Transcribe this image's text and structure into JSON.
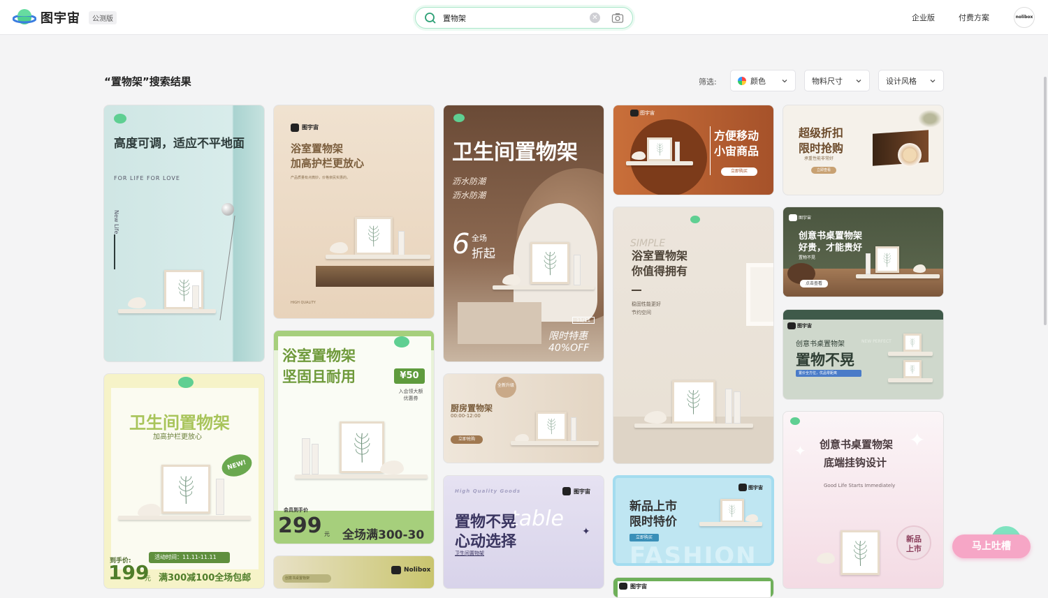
{
  "header": {
    "logo_text": "图宇宙",
    "beta_badge": "公测版",
    "search_value": "置物架",
    "nav_enterprise": "企业版",
    "nav_pricing": "付费方案",
    "avatar_text": "nolibox"
  },
  "results": {
    "title": "“置物架”搜索结果",
    "filter_label": "筛选:",
    "filter_color": "颜色",
    "filter_size": "物料尺寸",
    "filter_style": "设计风格"
  },
  "cards": {
    "c1": {
      "title": "高度可调，适应不平地面",
      "sub": "FOR LIFE FOR LOVE",
      "side": "New Life"
    },
    "c2": {
      "brand": "图宇宙",
      "title": "浴室置物架\n加高护栏更放心",
      "desc": "产品质量有点微妙，价格亲民实惠的。",
      "foot": "HIGH QUALITY"
    },
    "c3": {
      "title": "卫生间置物架",
      "sub1": "沥水防潮",
      "sub2": "沥水防潮",
      "big": "6",
      "big_a": "全场",
      "big_b": "折起",
      "date": "11/11",
      "sale": "限时特惠",
      "off": "40%OFF"
    },
    "c4": {
      "brand": "图宇宙",
      "title1": "方便移动",
      "title2": "小宙商品",
      "btn": "立即购买"
    },
    "c5": {
      "title1": "超级折扣",
      "title2": "限时抢购",
      "sub": "承重性能非常好",
      "btn": "立即查看"
    },
    "c6": {
      "title": "卫生间置物架",
      "sub": "加高护栏更放心",
      "tag": "NEW!",
      "price_label": "到手价:",
      "activity": "活动时间：11.11-11.11",
      "price": "199",
      "unit": "元",
      "promo": "满300减100全场包邮"
    },
    "c7": {
      "title1": "浴室置物架",
      "title2": "坚固且耐用",
      "coupon": "¥50",
      "coupon_sub": "入会领大额\n优惠券",
      "member": "会员到手价",
      "price": "299",
      "unit": "元",
      "promo": "全场满300-30"
    },
    "c8": {
      "badge": "全新升级",
      "title": "厨房置物架",
      "time": "00:00-12:00",
      "btn": "立即抢购"
    },
    "c9": {
      "script": "SIMPLE",
      "title1": "浴室置物架",
      "title2": "你值得拥有",
      "l1": "稳固性能更好",
      "l2": "节约空间"
    },
    "c10": {
      "brand": "图宇宙",
      "title1": "创意书桌置物架",
      "title2": "好贵，才能贵好",
      "sub": "置物不晃",
      "btn": "点击查看"
    },
    "c11": {
      "brand": "图宇宙",
      "sub": "创意书桌置物架",
      "title": "置物不晃",
      "tag": "置价全方位，优品零距离",
      "en": "NEW PERFECT"
    },
    "c12": {
      "brand": "Nolibox",
      "chip": "创意书桌置物架"
    },
    "c13": {
      "brand": "图宇宙",
      "en": "High Quality Goods",
      "script": "table",
      "title1": "置物不晃",
      "title2": "心动选择",
      "sub": "卫生间置物架"
    },
    "c14": {
      "brand": "图宇宙",
      "title1": "新品上市",
      "title2": "限时特价",
      "btn": "立即购买",
      "bg": "FASHION"
    },
    "c15": {
      "brand": "图宇宙"
    },
    "c16": {
      "title1": "创意书桌置物架",
      "title2": "底端挂钩设计",
      "en": "Good Life Starts Immediately",
      "badge": "新品\n上市"
    }
  },
  "feedback": {
    "label": "马上吐槽"
  }
}
